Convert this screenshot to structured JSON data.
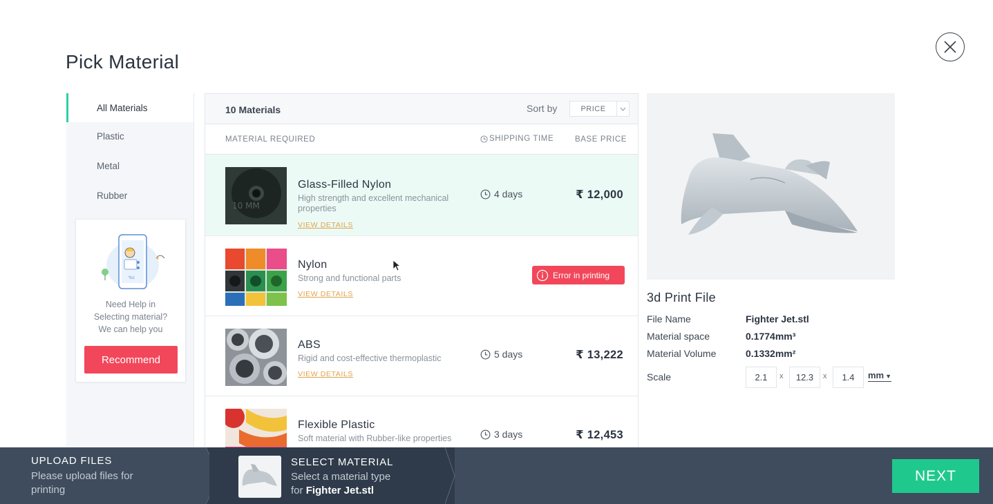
{
  "page": {
    "title": "Pick Material"
  },
  "sidebar": {
    "items": [
      {
        "label": "All Materials"
      },
      {
        "label": "Plastic"
      },
      {
        "label": "Metal"
      },
      {
        "label": "Rubber"
      }
    ],
    "help": {
      "text_line1": "Need Help in",
      "text_line2": "Selecting material?",
      "text_line3": "We can help you",
      "button_label": "Recommend"
    }
  },
  "list": {
    "count_label": "10 Materials",
    "sort_label": "Sort by",
    "sort_value": "PRICE",
    "columns": {
      "material": "MATERIAL REQUIRED",
      "shipping": "SHIPPING TIME",
      "price": "BASE PRICE"
    },
    "view_details_label": "VIEW DETAILS",
    "rows": [
      {
        "name": "Glass-Filled Nylon",
        "description": "High strength and excellent mechanical properties",
        "shipping": "4 days",
        "price": "₹ 12,000"
      },
      {
        "name": "Nylon",
        "description": "Strong and functional parts",
        "error": "Error in printing"
      },
      {
        "name": "ABS",
        "description": "Rigid and cost-effective thermoplastic",
        "shipping": "5 days",
        "price": "₹ 13,222"
      },
      {
        "name": "Flexible Plastic",
        "description": "Soft material with Rubber-like properties",
        "shipping": "3 days",
        "price": "₹ 12,453"
      }
    ]
  },
  "file": {
    "section_title": "3d Print File",
    "name_label": "File Name",
    "name_value": "Fighter Jet.stl",
    "space_label": "Material space",
    "space_value": "0.1774mm³",
    "volume_label": "Material Volume",
    "volume_value": "0.1332mm²",
    "scale_label": "Scale",
    "scale": [
      "2.1",
      "12.3",
      "1.4"
    ],
    "scale_sep": "x",
    "unit": "mm"
  },
  "steps": {
    "upload": {
      "title": "UPLOAD FILES",
      "sub1": "Please upload files for",
      "sub2": "printing"
    },
    "select": {
      "title": "SELECT MATERIAL",
      "sub1": "Select a material type",
      "sub2_prefix": "for",
      "sub2_file": "Fighter Jet.stl"
    },
    "next_label": "NEXT"
  },
  "colors": {
    "accent": "#2ccfa5",
    "danger": "#f2475a",
    "next": "#1fc98e",
    "bar": "#3e4c5d",
    "link": "#e0a34a"
  }
}
